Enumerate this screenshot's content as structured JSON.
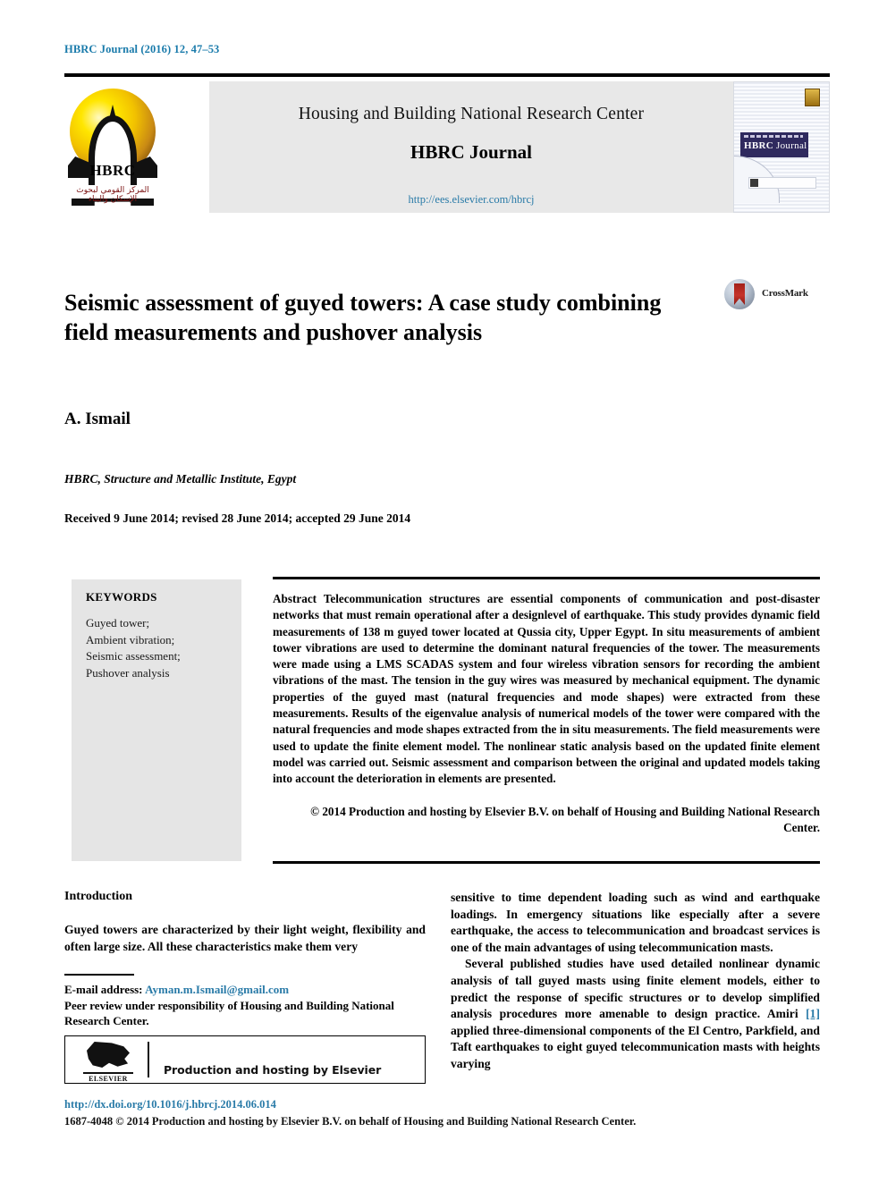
{
  "running_head": "HBRC Journal (2016) 12, 47–53",
  "banner": {
    "logo": {
      "acronym": "HBRC",
      "arabic": "المركز القومي لبحوث الإسكان والبناء"
    },
    "publisher": "Housing and Building National Research Center",
    "journal": "HBRC Journal",
    "url": "http://ees.elsevier.com/hbrcj",
    "cover": {
      "title_small": "Housing and Building National Research Center",
      "title_main": "HBRC",
      "title_main2": "Journal"
    }
  },
  "article": {
    "title": "Seismic assessment of guyed towers: A case study combining field measurements and pushover analysis",
    "crossmark_label": "CrossMark",
    "author": "A. Ismail",
    "affiliation": "HBRC, Structure and Metallic Institute, Egypt",
    "history": "Received 9 June 2014; revised 28 June 2014; accepted 29 June 2014"
  },
  "keywords": {
    "heading": "KEYWORDS",
    "items": [
      "Guyed tower;",
      "Ambient vibration;",
      "Seismic assessment;",
      "Pushover analysis"
    ]
  },
  "abstract": {
    "label": "Abstract",
    "text": "Telecommunication structures are essential components of communication and post-disaster networks that must remain operational after a designlevel of earthquake. This study provides dynamic field measurements of 138 m guyed tower located at Qussia city, Upper Egypt. In situ measurements of ambient tower vibrations are used to determine the dominant natural frequencies of the tower. The measurements were made using a LMS SCADAS system and four wireless vibration sensors for recording the ambient vibrations of the mast. The tension in the guy wires was measured by mechanical equipment. The dynamic properties of the guyed mast (natural frequencies and mode shapes) were extracted from these measurements. Results of the eigenvalue analysis of numerical models of the tower were compared with the natural frequencies and mode shapes extracted from the in situ measurements. The field measurements were used to update the finite element model. The nonlinear static analysis based on the updated finite element model was carried out. Seismic assessment and comparison between the original and updated models taking into account the deterioration in elements are presented.",
    "copyright": "© 2014 Production and hosting by Elsevier B.V. on behalf of Housing and Building National Research Center."
  },
  "body": {
    "section_heading": "Introduction",
    "left_paragraph": "Guyed towers are characterized by their light weight, flexibility and often large size. All these characteristics make them very",
    "right_paragraph_1": "sensitive to time dependent loading such as wind and earthquake loadings. In emergency situations like especially after a severe earthquake, the access to telecommunication and broadcast services is one of the main advantages of using telecommunication masts.",
    "right_paragraph_2a": "Several published studies have used detailed nonlinear dynamic analysis of tall guyed masts using finite element models, either to predict the response of specific structures or to develop simplified analysis procedures more amenable to design practice. Amiri ",
    "right_paragraph_2_ref": "[1]",
    "right_paragraph_2b": " applied three-dimensional components of the El Centro, Parkfield, and Taft earthquakes to eight guyed telecommunication masts with heights varying"
  },
  "footnote": {
    "email_label": "E-mail address:",
    "email": "Ayman.m.Ismail@gmail.com",
    "peer_review": "Peer review under responsibility of Housing and Building National Research Center."
  },
  "elsevier_box": {
    "wordmark": "ELSEVIER",
    "text": "Production and hosting by Elsevier"
  },
  "footer": {
    "doi": "http://dx.doi.org/10.1016/j.hbrcj.2014.06.014",
    "issn_line": "1687-4048 © 2014 Production and hosting by Elsevier B.V. on behalf of Housing and Building National Research Center."
  },
  "colors": {
    "link": "#2a7ba8",
    "banner_bg": "#e8e8e8",
    "keyword_bg": "#e5e5e5",
    "crossmark_red": "#b5281f"
  }
}
